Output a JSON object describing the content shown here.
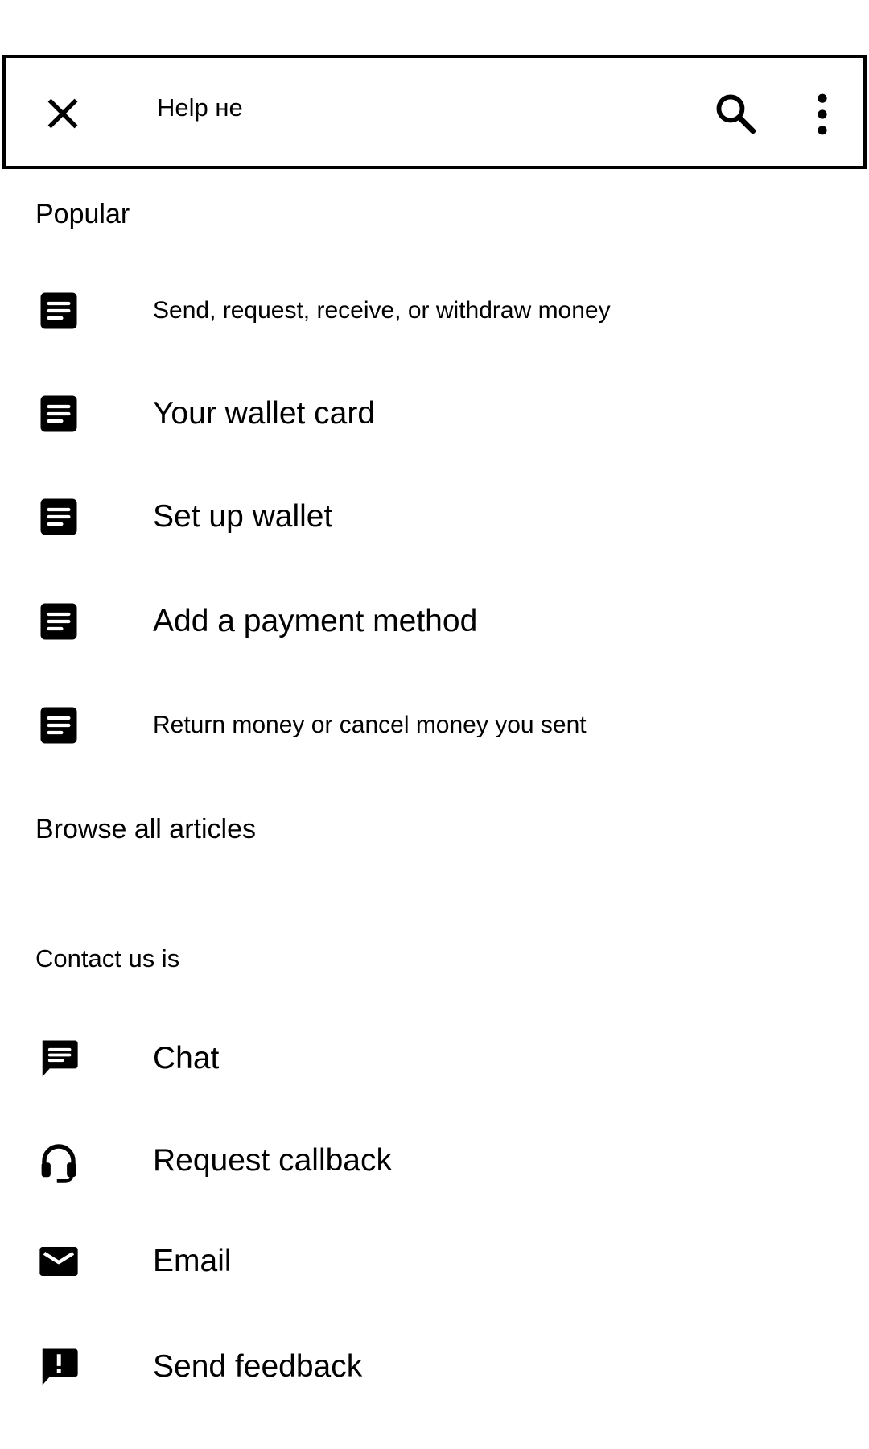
{
  "header": {
    "title": "Help не",
    "close_icon": "close-icon",
    "search_icon": "search-icon",
    "more_icon": "more-vert-icon"
  },
  "popular": {
    "heading": "Popular",
    "items": [
      {
        "label": "Send, request, receive, or withdraw money",
        "icon": "article-icon"
      },
      {
        "label": "Your wallet card",
        "icon": "article-icon"
      },
      {
        "label": "Set up wallet",
        "icon": "article-icon"
      },
      {
        "label": "Add a payment method",
        "icon": "article-icon"
      },
      {
        "label": "Return money or cancel money you sent",
        "icon": "article-icon"
      }
    ]
  },
  "browse": {
    "label": "Browse all articles"
  },
  "contact": {
    "heading": "Contact us is",
    "items": [
      {
        "label": "Chat",
        "icon": "chat-icon"
      },
      {
        "label": "Request callback",
        "icon": "headset-icon"
      },
      {
        "label": "Email",
        "icon": "email-icon"
      },
      {
        "label": "Send feedback",
        "icon": "feedback-icon"
      }
    ]
  },
  "colors": {
    "text": "#000000",
    "background": "#ffffff",
    "border": "#000000"
  }
}
